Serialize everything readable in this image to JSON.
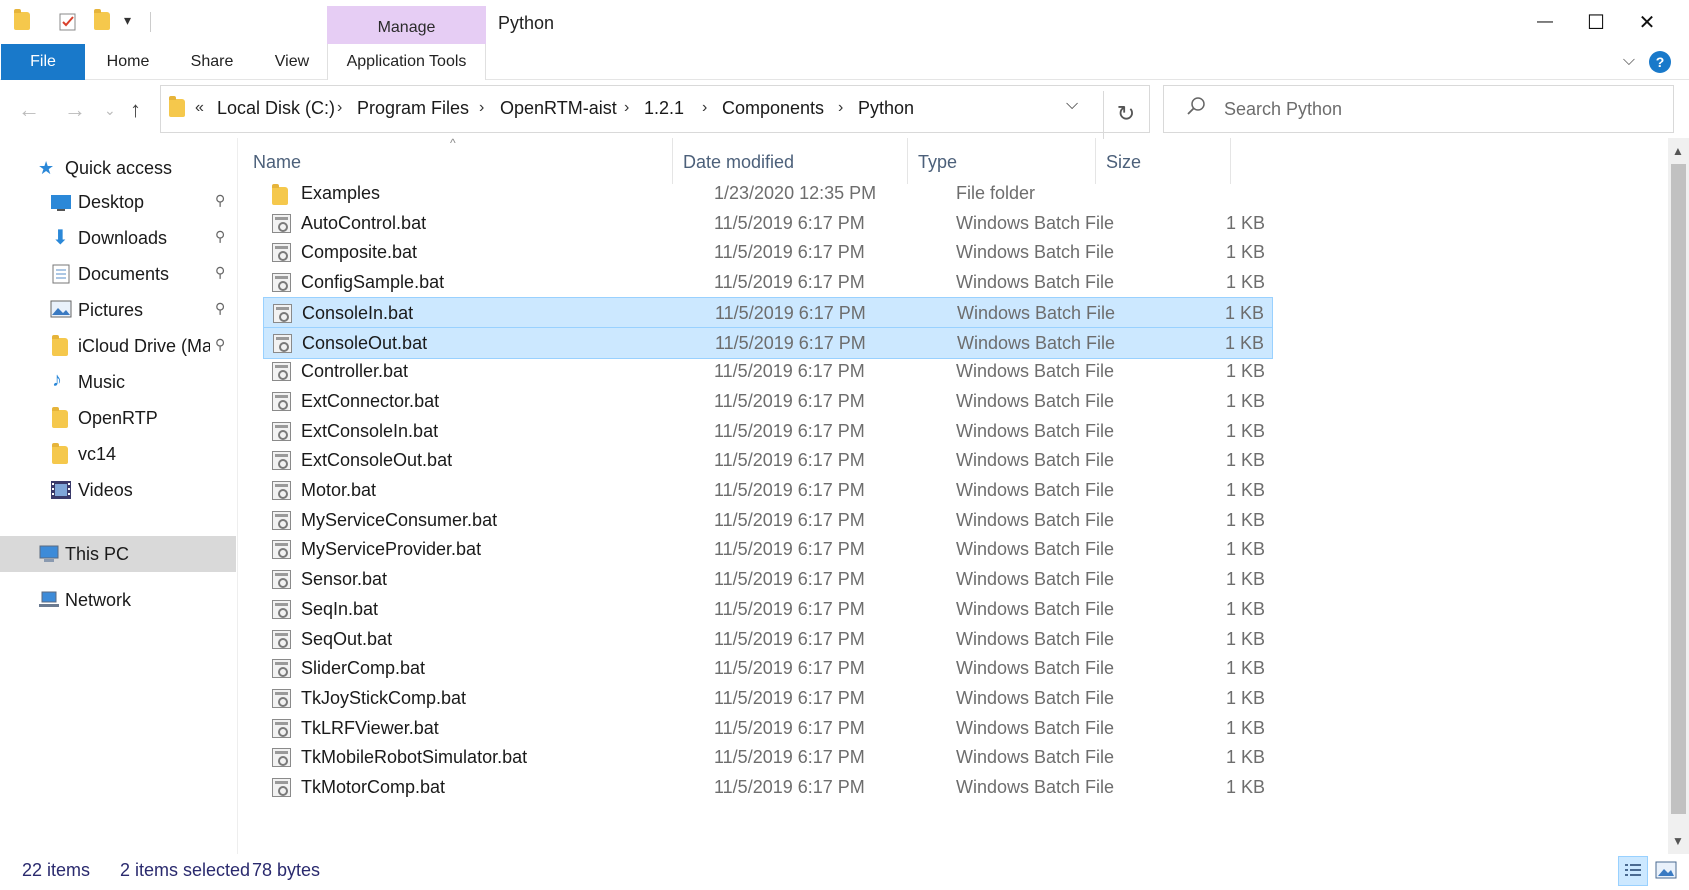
{
  "window": {
    "title": "Python",
    "manage_tab": "Manage",
    "minimize_glyph": "—",
    "maximize_glyph": "☐",
    "close_glyph": "✕"
  },
  "ribbon": {
    "tabs": [
      "File",
      "Home",
      "Share",
      "View",
      "Application Tools"
    ],
    "expand_glyph": "⌵",
    "help_glyph": "?"
  },
  "address": {
    "prefix": "«",
    "crumbs": [
      "Local Disk (C:)",
      "Program Files",
      "OpenRTM-aist",
      "1.2.1",
      "Components",
      "Python"
    ],
    "separator": "›",
    "dropdown_glyph": "⌵",
    "refresh_glyph": "↻"
  },
  "nav_glyphs": {
    "back": "←",
    "forward": "→",
    "recent": "⌄",
    "up": "↑"
  },
  "search": {
    "placeholder": "Search Python",
    "value": ""
  },
  "navpane": {
    "pin_glyph": "📌",
    "items": [
      {
        "label": "Quick access",
        "icon": "star-icon"
      },
      {
        "label": "Desktop",
        "icon": "desktop-icon",
        "pinned": true
      },
      {
        "label": "Downloads",
        "icon": "download-icon",
        "pinned": true
      },
      {
        "label": "Documents",
        "icon": "documents-icon",
        "pinned": true
      },
      {
        "label": "Pictures",
        "icon": "pictures-icon",
        "pinned": true
      },
      {
        "label": "iCloud Drive (Ma",
        "icon": "folder-icon",
        "pinned": true
      },
      {
        "label": "Music",
        "icon": "music-icon"
      },
      {
        "label": "OpenRTP",
        "icon": "folder-icon"
      },
      {
        "label": "vc14",
        "icon": "folder-icon"
      },
      {
        "label": "Videos",
        "icon": "videos-icon"
      },
      {
        "label": "This PC",
        "icon": "computer-icon",
        "selected": true
      },
      {
        "label": "Network",
        "icon": "network-icon"
      }
    ]
  },
  "columns": {
    "name": "Name",
    "date": "Date modified",
    "type": "Type",
    "size": "Size",
    "sort_glyph": "^"
  },
  "files": [
    {
      "name": "Examples",
      "date": "1/23/2020 12:35 PM",
      "type": "File folder",
      "size": "",
      "kind": "folder"
    },
    {
      "name": "AutoControl.bat",
      "date": "11/5/2019 6:17 PM",
      "type": "Windows Batch File",
      "size": "1 KB",
      "kind": "bat"
    },
    {
      "name": "Composite.bat",
      "date": "11/5/2019 6:17 PM",
      "type": "Windows Batch File",
      "size": "1 KB",
      "kind": "bat"
    },
    {
      "name": "ConfigSample.bat",
      "date": "11/5/2019 6:17 PM",
      "type": "Windows Batch File",
      "size": "1 KB",
      "kind": "bat"
    },
    {
      "name": "ConsoleIn.bat",
      "date": "11/5/2019 6:17 PM",
      "type": "Windows Batch File",
      "size": "1 KB",
      "kind": "bat",
      "selected": true
    },
    {
      "name": "ConsoleOut.bat",
      "date": "11/5/2019 6:17 PM",
      "type": "Windows Batch File",
      "size": "1 KB",
      "kind": "bat",
      "selected": true
    },
    {
      "name": "Controller.bat",
      "date": "11/5/2019 6:17 PM",
      "type": "Windows Batch File",
      "size": "1 KB",
      "kind": "bat"
    },
    {
      "name": "ExtConnector.bat",
      "date": "11/5/2019 6:17 PM",
      "type": "Windows Batch File",
      "size": "1 KB",
      "kind": "bat"
    },
    {
      "name": "ExtConsoleIn.bat",
      "date": "11/5/2019 6:17 PM",
      "type": "Windows Batch File",
      "size": "1 KB",
      "kind": "bat"
    },
    {
      "name": "ExtConsoleOut.bat",
      "date": "11/5/2019 6:17 PM",
      "type": "Windows Batch File",
      "size": "1 KB",
      "kind": "bat"
    },
    {
      "name": "Motor.bat",
      "date": "11/5/2019 6:17 PM",
      "type": "Windows Batch File",
      "size": "1 KB",
      "kind": "bat"
    },
    {
      "name": "MyServiceConsumer.bat",
      "date": "11/5/2019 6:17 PM",
      "type": "Windows Batch File",
      "size": "1 KB",
      "kind": "bat"
    },
    {
      "name": "MyServiceProvider.bat",
      "date": "11/5/2019 6:17 PM",
      "type": "Windows Batch File",
      "size": "1 KB",
      "kind": "bat"
    },
    {
      "name": "Sensor.bat",
      "date": "11/5/2019 6:17 PM",
      "type": "Windows Batch File",
      "size": "1 KB",
      "kind": "bat"
    },
    {
      "name": "SeqIn.bat",
      "date": "11/5/2019 6:17 PM",
      "type": "Windows Batch File",
      "size": "1 KB",
      "kind": "bat"
    },
    {
      "name": "SeqOut.bat",
      "date": "11/5/2019 6:17 PM",
      "type": "Windows Batch File",
      "size": "1 KB",
      "kind": "bat"
    },
    {
      "name": "SliderComp.bat",
      "date": "11/5/2019 6:17 PM",
      "type": "Windows Batch File",
      "size": "1 KB",
      "kind": "bat"
    },
    {
      "name": "TkJoyStickComp.bat",
      "date": "11/5/2019 6:17 PM",
      "type": "Windows Batch File",
      "size": "1 KB",
      "kind": "bat"
    },
    {
      "name": "TkLRFViewer.bat",
      "date": "11/5/2019 6:17 PM",
      "type": "Windows Batch File",
      "size": "1 KB",
      "kind": "bat"
    },
    {
      "name": "TkMobileRobotSimulator.bat",
      "date": "11/5/2019 6:17 PM",
      "type": "Windows Batch File",
      "size": "1 KB",
      "kind": "bat"
    },
    {
      "name": "TkMotorComp.bat",
      "date": "11/5/2019 6:17 PM",
      "type": "Windows Batch File",
      "size": "1 KB",
      "kind": "bat"
    }
  ],
  "status": {
    "item_count": "22 items",
    "selection": "2 items selected",
    "size": "78 bytes"
  },
  "colors": {
    "accent": "#1979ca",
    "manage_tab": "#e6cdf4",
    "selection_bg": "#cce8ff",
    "selection_border": "#99d1ff",
    "folder": "#f5c84c"
  }
}
